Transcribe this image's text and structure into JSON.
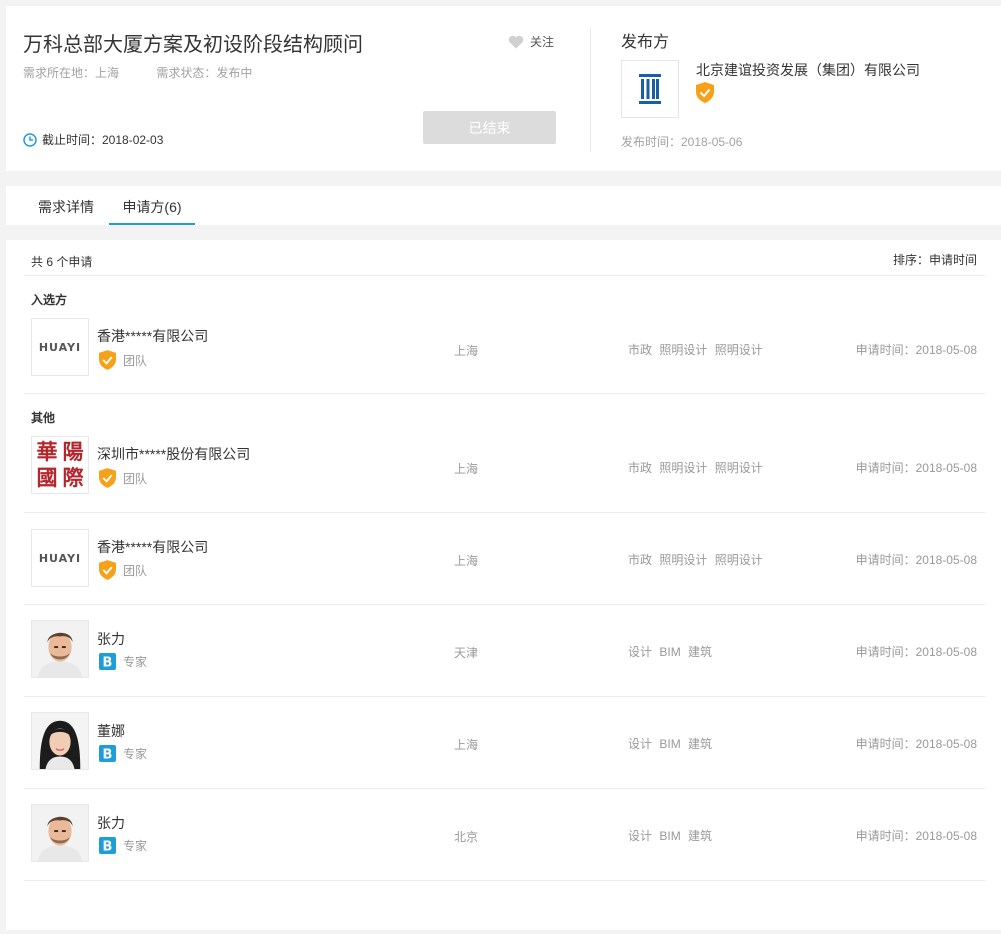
{
  "header": {
    "title": "万科总部大厦方案及初设阶段结构顾问",
    "location": "需求所在地：上海",
    "status": "需求状态：发布中",
    "follow_label": "关注",
    "deadline": "截止时间：2018-02-03",
    "ended_button": "已结束",
    "publisher_label": "发布方",
    "publisher_name": "北京建谊投资发展（集团）有限公司",
    "publish_time": "发布时间：2018-05-06"
  },
  "tabs": [
    {
      "label": "需求详情",
      "active": false
    },
    {
      "label": "申请方(6)",
      "active": true
    }
  ],
  "list": {
    "total": "共 6 个申请",
    "sort": "排序：申请时间",
    "sections": [
      "入选方",
      "其他"
    ],
    "rows": [
      {
        "name": "香港*****有限公司",
        "avatar": "huayi-logo",
        "badge_icon": "verified-shield-icon",
        "type": "团队",
        "city": "上海",
        "tags": [
          "市政",
          "照明设计",
          "照明设计"
        ],
        "time": "申请时间：2018-05-08"
      },
      {
        "name": "深圳市*****股份有限公司",
        "avatar": "huayang-logo",
        "logo_text": [
          "華",
          "陽",
          "國",
          "際"
        ],
        "badge_icon": "verified-shield-icon",
        "type": "团队",
        "city": "上海",
        "tags": [
          "市政",
          "照明设计",
          "照明设计"
        ],
        "time": "申请时间：2018-05-08"
      },
      {
        "name": "香港*****有限公司",
        "avatar": "huayi-logo",
        "badge_icon": "verified-shield-icon",
        "type": "团队",
        "city": "上海",
        "tags": [
          "市政",
          "照明设计",
          "照明设计"
        ],
        "time": "申请时间：2018-05-08"
      },
      {
        "name": "张力",
        "avatar": "male-photo",
        "badge_icon": "expert-b-icon",
        "type": "专家",
        "city": "天津",
        "tags": [
          "设计",
          "BIM",
          "建筑"
        ],
        "time": "申请时间：2018-05-08"
      },
      {
        "name": "董娜",
        "avatar": "female-photo",
        "badge_icon": "expert-b-icon",
        "type": "专家",
        "city": "上海",
        "tags": [
          "设计",
          "BIM",
          "建筑"
        ],
        "time": "申请时间：2018-05-08"
      },
      {
        "name": "张力",
        "avatar": "male-photo",
        "badge_icon": "expert-b-icon",
        "type": "专家",
        "city": "北京",
        "tags": [
          "设计",
          "BIM",
          "建筑"
        ],
        "time": "申请时间：2018-05-08"
      }
    ]
  },
  "huayi_logo_text": "HUAYI",
  "colors": {
    "accent": "#1e9ddb",
    "badge": "#f7a11a",
    "disabled": "#dcdcdc"
  }
}
